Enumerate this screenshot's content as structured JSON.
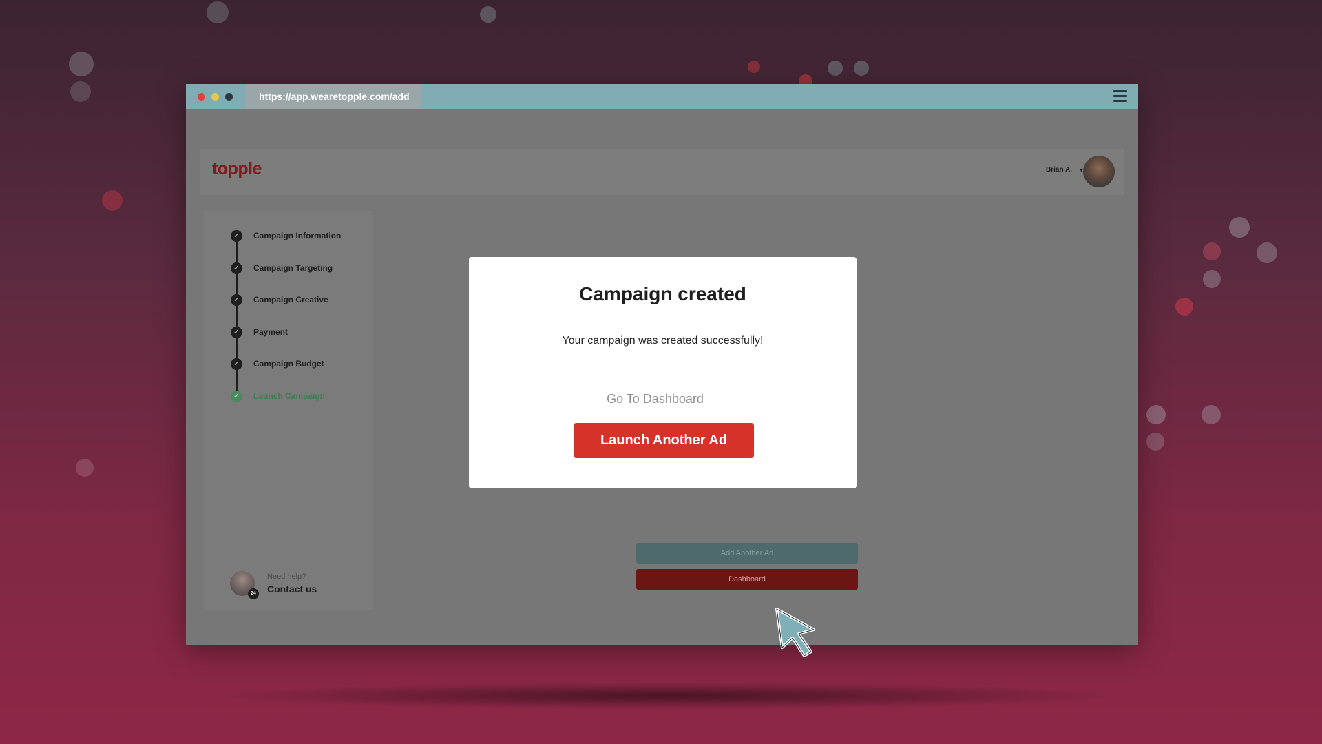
{
  "browser": {
    "url": "https://app.wearetopple.com/add",
    "dots": [
      "#e0413a",
      "#e3c94a",
      "#2b3a40"
    ]
  },
  "app": {
    "logo": "topple",
    "user_name": "Brian A.",
    "user_caret": "▾"
  },
  "steps": [
    {
      "label": "Campaign Information",
      "done": true
    },
    {
      "label": "Campaign Targeting",
      "done": true
    },
    {
      "label": "Campaign Creative",
      "done": true
    },
    {
      "label": "Payment",
      "done": true
    },
    {
      "label": "Campaign Budget",
      "done": true
    },
    {
      "label": "Launch Campaign",
      "done": true,
      "active": true
    }
  ],
  "help": {
    "need": "Need help?",
    "contact": "Contact us",
    "badge": "24"
  },
  "background_buttons": {
    "add_another_ad": "Add Another Ad",
    "dashboard": "Dashboard"
  },
  "modal": {
    "title": "Campaign created",
    "message": "Your campaign was created successfully!",
    "link": "Go To Dashboard",
    "cta": "Launch Another Ad"
  },
  "colors": {
    "brand": "#7c1d1b",
    "cta": "#d5322a",
    "active_step": "#3d7f50",
    "titlebar": "#7fadb3"
  },
  "icons": {
    "check": "✓"
  }
}
